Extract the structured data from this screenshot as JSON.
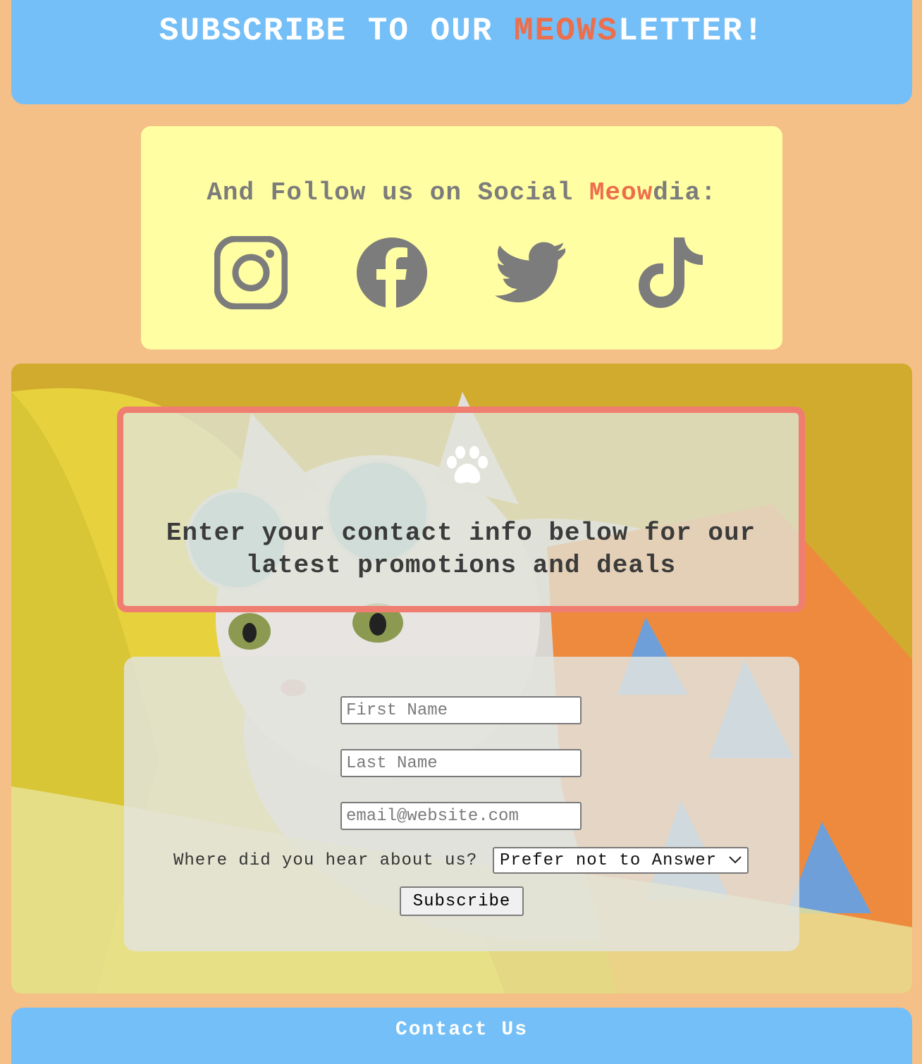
{
  "header": {
    "title_prefix": "SUBSCRIBE TO OUR ",
    "title_accent": "MEOWS",
    "title_suffix": "LETTER!"
  },
  "social": {
    "heading_prefix": "And Follow us on Social ",
    "heading_accent": "Meow",
    "heading_suffix": "dia:",
    "icons": [
      "instagram-icon",
      "facebook-icon",
      "twitter-icon",
      "tiktok-icon"
    ]
  },
  "promo": {
    "icon": "paw-icon",
    "line1": "Enter your contact info below for our",
    "line2": "latest promotions and deals"
  },
  "form": {
    "first_name_placeholder": "First Name",
    "last_name_placeholder": "Last Name",
    "email_placeholder": "email@website.com",
    "hear_label": "Where did you hear about us?",
    "hear_selected": "Prefer not to Answer",
    "submit_label": "Subscribe"
  },
  "footer": {
    "contact_label": "Contact Us"
  },
  "colors": {
    "page_bg": "#f4c087",
    "header_bg": "#74bff7",
    "accent": "#ec6e4c",
    "social_bg": "#fffea2",
    "icon_gray": "#7c7c7c",
    "promo_border": "#ef7d70"
  }
}
